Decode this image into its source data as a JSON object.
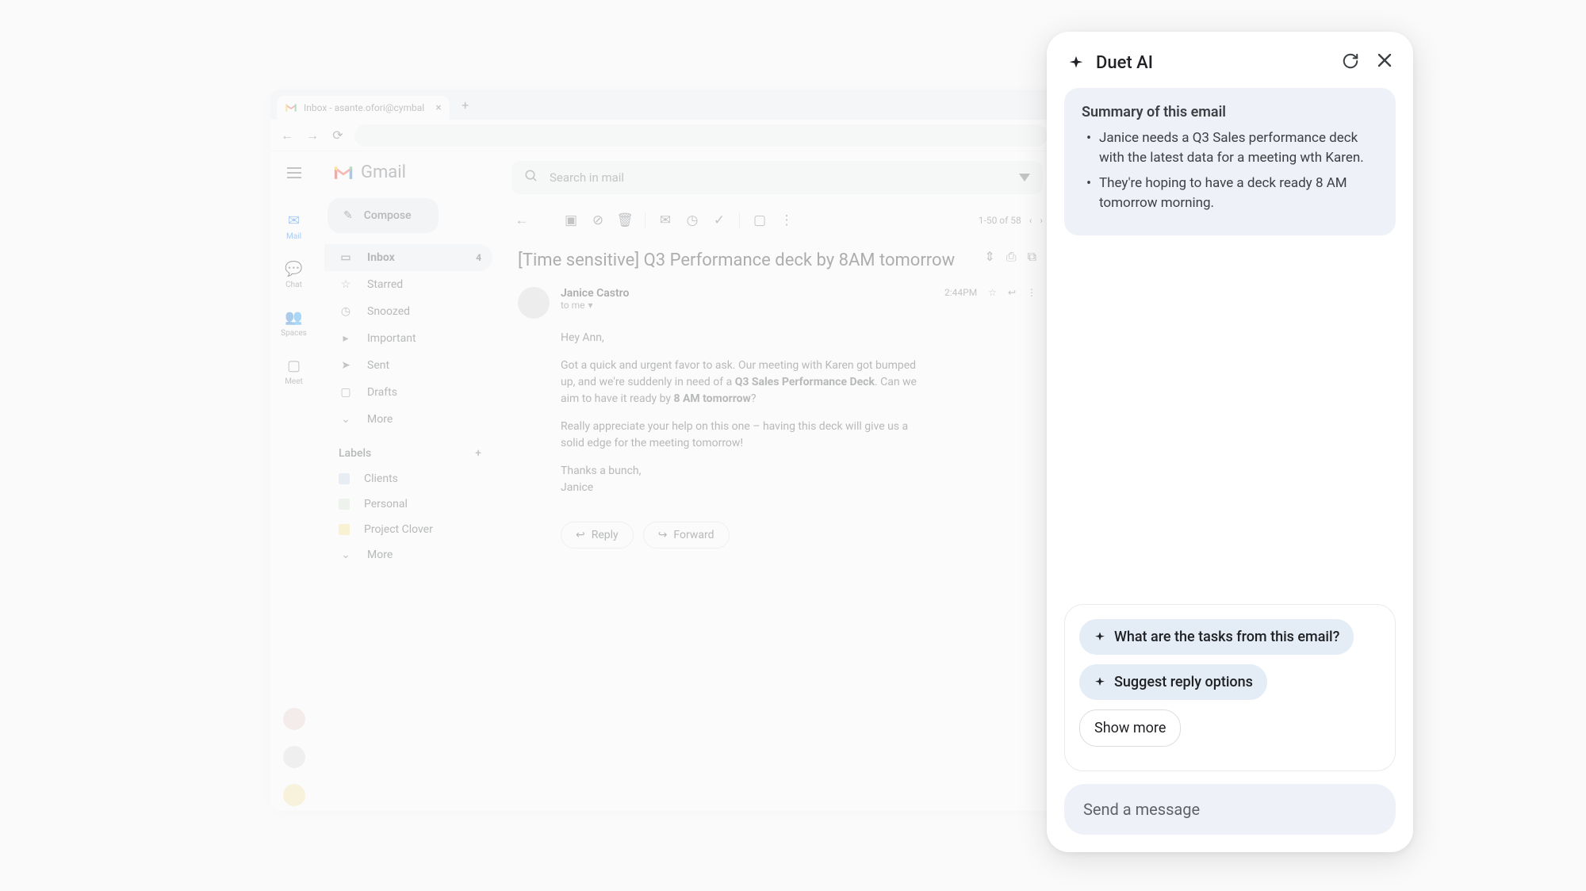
{
  "browser": {
    "tab_title": "Inbox - asante.ofori@cymbal"
  },
  "rail": {
    "items": [
      {
        "label": "Mail"
      },
      {
        "label": "Chat"
      },
      {
        "label": "Spaces"
      },
      {
        "label": "Meet"
      }
    ]
  },
  "brand": "Gmail",
  "compose": "Compose",
  "search_placeholder": "Search in mail",
  "nav": {
    "inbox": {
      "label": "Inbox",
      "count": "4"
    },
    "starred": "Starred",
    "snoozed": "Snoozed",
    "important": "Important",
    "sent": "Sent",
    "drafts": "Drafts",
    "more": "More"
  },
  "labels_header": "Labels",
  "labels": {
    "clients": "Clients",
    "personal": "Personal",
    "project_clover": "Project Clover",
    "more": "More"
  },
  "pager": "1-50 of 58",
  "message": {
    "subject": "[Time sensitive] Q3 Performance deck by 8AM tomorrow",
    "sender": "Janice Castro",
    "to": "to me",
    "time": "2:44PM",
    "body": {
      "greeting": "Hey Ann,",
      "p1a": "Got a quick and urgent favor to ask. Our meeting with Karen got bumped up, and we're suddenly in need of a ",
      "p1b": "Q3 Sales Performance Deck",
      "p1c": ". Can we aim to have it ready by ",
      "p1d": "8 AM tomorrow",
      "p1e": "?",
      "p2": "Really appreciate your help on this one – having this deck will give us a solid edge for the meeting tomorrow!",
      "closing": "Thanks a bunch,",
      "sig": "Janice"
    },
    "reply": "Reply",
    "forward": "Forward"
  },
  "duet": {
    "title": "Duet AI",
    "summary_title": "Summary of this email",
    "summary": [
      "Janice needs a Q3 Sales performance deck with the latest data for a meeting wth Karen.",
      "They're hoping to have a deck ready 8 AM tomorrow morning."
    ],
    "chip1": "What are the tasks from this email?",
    "chip2": "Suggest reply options",
    "show_more": "Show more",
    "input_placeholder": "Send a message"
  }
}
